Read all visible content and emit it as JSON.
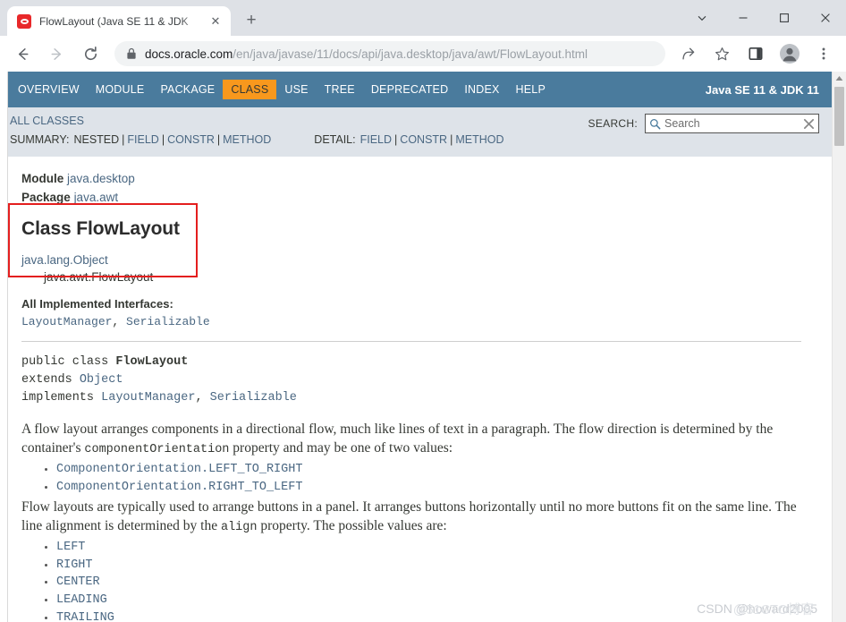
{
  "window": {
    "controls": [
      "chevron-down",
      "minimize",
      "maximize",
      "close"
    ]
  },
  "browser": {
    "tab": {
      "title": "FlowLayout (Java SE 11 & JDK",
      "close_label": "✕"
    },
    "new_tab_label": "+",
    "toolbar": {
      "back_label": "←",
      "forward_label": "→",
      "reload_label": "⟳",
      "url_host": "docs.oracle.com",
      "url_path": "/en/java/javase/11/docs/api/java.desktop/java/awt/FlowLayout.html"
    }
  },
  "javadoc": {
    "topnav": {
      "links": [
        {
          "label": "OVERVIEW",
          "active": false
        },
        {
          "label": "MODULE",
          "active": false
        },
        {
          "label": "PACKAGE",
          "active": false
        },
        {
          "label": "CLASS",
          "active": true
        },
        {
          "label": "USE",
          "active": false
        },
        {
          "label": "TREE",
          "active": false
        },
        {
          "label": "DEPRECATED",
          "active": false
        },
        {
          "label": "INDEX",
          "active": false
        },
        {
          "label": "HELP",
          "active": false
        }
      ],
      "title": "Java SE 11 & JDK 11",
      "bg_color": "#4a7b9d",
      "active_color": "#f8981d"
    },
    "subnav": {
      "all_classes": "ALL CLASSES",
      "summary_label": "SUMMARY:",
      "summary_items": [
        "NESTED",
        "FIELD",
        "CONSTR",
        "METHOD"
      ],
      "detail_label": "DETAIL:",
      "detail_items": [
        "FIELD",
        "CONSTR",
        "METHOD"
      ],
      "search_label": "SEARCH:",
      "search_placeholder": "Search",
      "search_value": "",
      "search_icon": "magnifier-icon",
      "clear_icon": "clear-icon"
    },
    "header": {
      "module_label": "Module",
      "module_name": "java.desktop",
      "package_label": "Package",
      "package_name": "java.awt",
      "class_title": "Class FlowLayout",
      "inheritance": [
        "java.lang.Object",
        "java.awt.FlowLayout"
      ],
      "annotation_box_color": "#e41e1e"
    },
    "interfaces": {
      "heading": "All Implemented Interfaces:",
      "items": [
        "LayoutManager",
        "Serializable"
      ]
    },
    "signature": {
      "line1_prefix": "public class ",
      "line1_name": "FlowLayout",
      "line2_prefix": "extends ",
      "line2_type": "Object",
      "line3_prefix": "implements ",
      "line3_types": [
        "LayoutManager",
        "Serializable"
      ]
    },
    "description": {
      "p1_a": "A flow layout arranges components in a directional flow, much like lines of text in a paragraph. The flow direction is determined by the container's ",
      "p1_code": "componentOrientation",
      "p1_b": " property and may be one of two values:",
      "orientation_values": [
        "ComponentOrientation.LEFT_TO_RIGHT",
        "ComponentOrientation.RIGHT_TO_LEFT"
      ],
      "p2_a": "Flow layouts are typically used to arrange buttons in a panel. It arranges buttons horizontally until no more buttons fit on the same line. The line alignment is determined by the ",
      "p2_code": "align",
      "p2_b": " property. The possible values are:",
      "align_values": [
        "LEFT",
        "RIGHT",
        "CENTER",
        "LEADING",
        "TRAILING"
      ]
    },
    "watermark": {
      "front": "CSDN @howard2005",
      "back": "@51CTO博客"
    }
  }
}
